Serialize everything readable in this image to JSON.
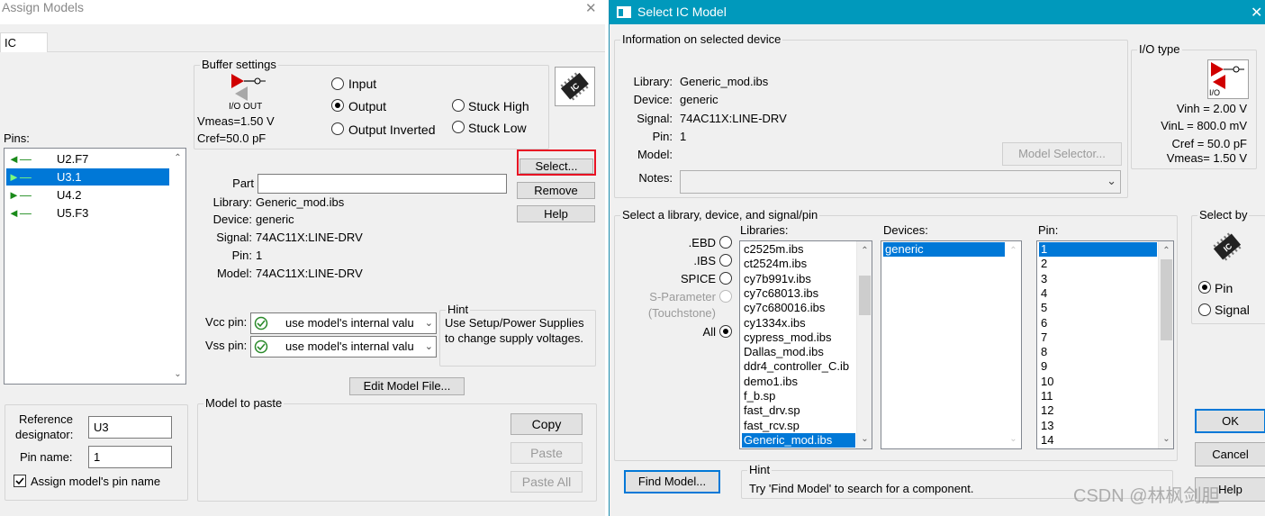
{
  "assign": {
    "title": "Assign Models",
    "close": "✕",
    "tab": "IC",
    "pins_label": "Pins:",
    "pins": [
      {
        "label": "U2.F7",
        "icon": "input-arrow-icon",
        "selected": false
      },
      {
        "label": "U3.1",
        "icon": "output-arrow-icon",
        "selected": true
      },
      {
        "label": "U4.2",
        "icon": "output-arrow-icon",
        "selected": false
      },
      {
        "label": "U5.F3",
        "icon": "input-arrow-icon",
        "selected": false
      }
    ],
    "buffer": {
      "caption": "Buffer settings",
      "io_label": "I/O  OUT",
      "vmeas": "Vmeas=1.50 V",
      "cref": "Cref=50.0 pF",
      "radios": {
        "input": "Input",
        "output": "Output",
        "output_inverted": "Output Inverted",
        "stuck_high": "Stuck High",
        "stuck_low": "Stuck Low"
      },
      "selected": "output"
    },
    "buttons": {
      "select": "Select...",
      "remove": "Remove",
      "help": "Help",
      "edit_model_file": "Edit Model File...",
      "copy": "Copy",
      "paste": "Paste",
      "paste_all": "Paste All"
    },
    "info": {
      "part_label": "Part",
      "part_value": "",
      "library_label": "Library:",
      "library": "Generic_mod.ibs",
      "device_label": "Device:",
      "device": "generic",
      "signal_label": "Signal:",
      "signal": "74AC11X:LINE-DRV",
      "pin_label": "Pin:",
      "pin": "1",
      "model_label": "Model:",
      "model": "74AC11X:LINE-DRV"
    },
    "supply": {
      "vcc_label": "Vcc pin:",
      "vcc_value": "use model's internal valu",
      "vss_label": "Vss pin:",
      "vss_value": "use model's internal valu"
    },
    "hint": {
      "caption": "Hint",
      "text1": "Use Setup/Power Supplies",
      "text2": "to change supply voltages."
    },
    "ref": {
      "ref_label1": "Reference",
      "ref_label2": "designator:",
      "ref_value": "U3",
      "pin_name_label": "Pin name:",
      "pin_name_value": "1",
      "assign_checkbox": "Assign model's pin name",
      "assign_checked": true
    },
    "paste_caption": "Model to paste"
  },
  "select": {
    "title": "Select IC Model",
    "close": "✕",
    "info_caption": "Information on selected device",
    "library_label": "Library:",
    "library": "Generic_mod.ibs",
    "device_label": "Device:",
    "device": "generic",
    "signal_label": "Signal:",
    "signal": "74AC11X:LINE-DRV",
    "pin_label": "Pin:",
    "pin": "1",
    "model_label": "Model:",
    "model": "",
    "model_selector": "Model Selector...",
    "notes_label": "Notes:",
    "iotype": {
      "caption": "I/O type",
      "io_small": "I/O",
      "vinh": "Vinh = 2.00 V",
      "vinl": "VinL = 800.0 mV",
      "cref": "Cref = 50.0 pF",
      "vmeas": "Vmeas= 1.50 V"
    },
    "lib_caption": "Select a library, device, and signal/pin",
    "filters": {
      "ebd": ".EBD",
      "ibs": ".IBS",
      "spice": "SPICE",
      "sparam1": "S-Parameter",
      "sparam2": "(Touchstone)",
      "all": "All",
      "selected": "all"
    },
    "libraries_label": "Libraries:",
    "libraries": [
      "c2525m.ibs",
      "ct2524m.ibs",
      "cy7b991v.ibs",
      "cy7c68013.ibs",
      "cy7c680016.ibs",
      "cy1334x.ibs",
      "cypress_mod.ibs",
      "Dallas_mod.ibs",
      "ddr4_controller_C.ib",
      "demo1.ibs",
      "f_b.sp",
      "fast_drv.sp",
      "fast_rcv.sp",
      "Generic_mod.ibs"
    ],
    "library_selected": 13,
    "devices_label": "Devices:",
    "devices": [
      "generic"
    ],
    "pins_label": "Pin:",
    "pins": [
      "1",
      "2",
      "3",
      "4",
      "5",
      "6",
      "7",
      "8",
      "9",
      "10",
      "11",
      "12",
      "13",
      "14"
    ],
    "pin_selected": 0,
    "select_by": {
      "caption": "Select by",
      "pin": "Pin",
      "signal": "Signal",
      "selected": "pin"
    },
    "ok": "OK",
    "cancel": "Cancel",
    "help_partial": "Help",
    "find_model": "Find Model...",
    "hint_caption": "Hint",
    "hint_text": "Try 'Find Model' to search for a component.",
    "colors": {
      "titlebar": "#0099bc",
      "selection": "#0078d7",
      "highlight": "#e81123"
    }
  },
  "watermark": "CSDN @林枫剑胆"
}
